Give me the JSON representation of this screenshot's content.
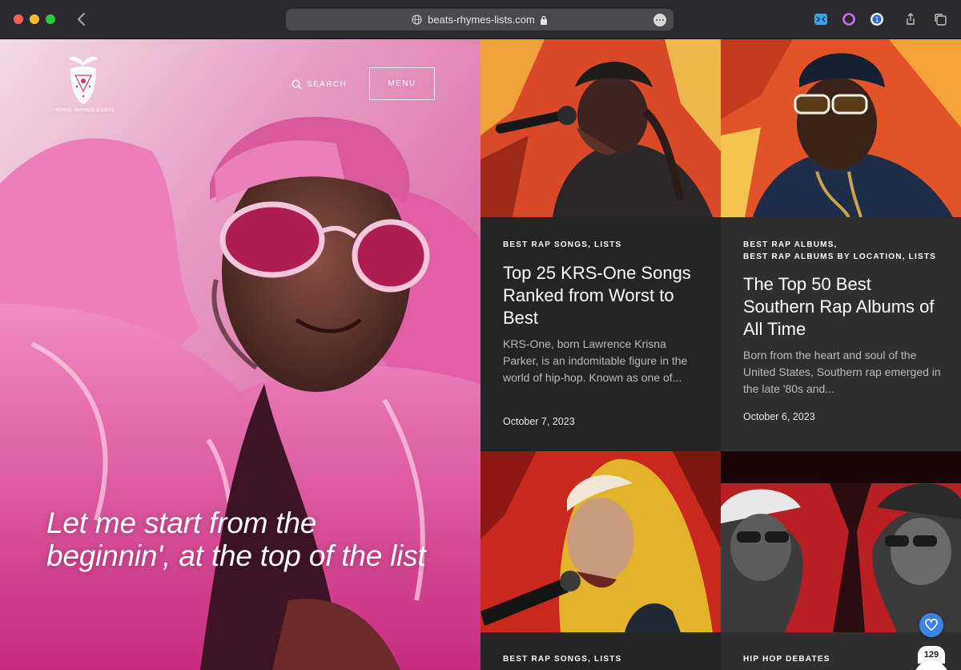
{
  "browser": {
    "url": "beats-rhymes-lists.com",
    "icons": [
      "back-icon",
      "globe-icon",
      "lock-icon",
      "more-icon",
      "extension-mask-icon",
      "extension-ring-icon",
      "extension-one-icon",
      "share-icon",
      "tabs-icon"
    ]
  },
  "site": {
    "logo_text": "BEATS, RHYMES & LISTS",
    "search_label": "SEARCH",
    "menu_label": "MENU",
    "hero_quote": "Let me start from the beginnin', at the top of the list"
  },
  "cards": [
    {
      "categories": "BEST RAP SONGS, LISTS",
      "title": "Top 25 KRS-One Songs Ranked from Worst to Best",
      "excerpt": "KRS-One, born Lawrence Krisna Parker, is an indomitable figure in the world of hip-hop. Known as one of...",
      "date": "October 7, 2023"
    },
    {
      "categories_line1": "BEST RAP ALBUMS,",
      "categories_line2": "BEST RAP ALBUMS BY LOCATION, LISTS",
      "title": "The Top 50 Best Southern Rap Albums of All Time",
      "excerpt": "Born from the heart and soul of the United States, Southern rap emerged in the late '80s and...",
      "date": "October 6, 2023"
    },
    {
      "categories": "BEST RAP SONGS, LISTS"
    },
    {
      "categories": "HIP HOP DEBATES"
    }
  ],
  "share": {
    "count": "129"
  },
  "colors": {
    "hero_pink": "#e0479a",
    "card_dark": "#242424",
    "card_mid": "#2f2f2f",
    "accent_blue": "#3a86e6"
  }
}
